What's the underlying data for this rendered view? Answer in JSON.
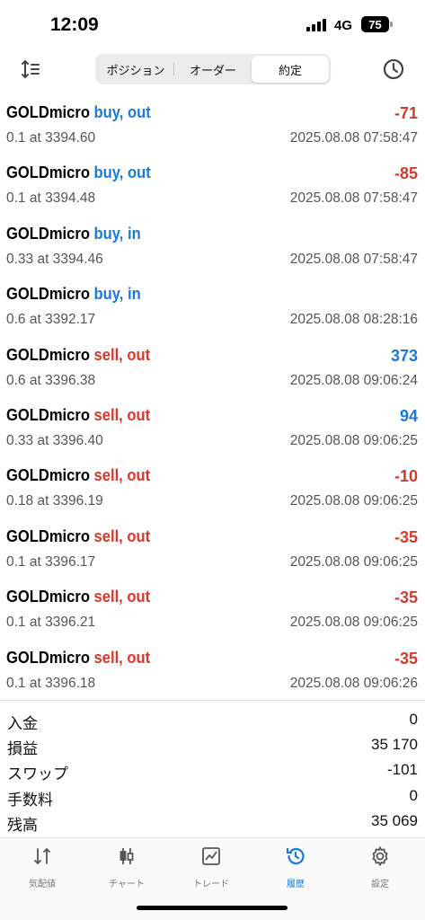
{
  "status": {
    "time": "12:09",
    "network": "4G",
    "battery": "75"
  },
  "tabs_top": [
    {
      "label": "ポジション"
    },
    {
      "label": "オーダー"
    },
    {
      "label": "約定"
    }
  ],
  "deals": [
    {
      "symbol": "GOLDmicro",
      "action": "buy, out",
      "side": "buy",
      "profit": "-71",
      "sign": "neg",
      "volume": "0.1 at 3394.60",
      "time": "2025.08.08 07:58:47"
    },
    {
      "symbol": "GOLDmicro",
      "action": "buy, out",
      "side": "buy",
      "profit": "-85",
      "sign": "neg",
      "volume": "0.1 at 3394.48",
      "time": "2025.08.08 07:58:47"
    },
    {
      "symbol": "GOLDmicro",
      "action": "buy, in",
      "side": "buy",
      "profit": "",
      "sign": "neg",
      "volume": "0.33 at 3394.46",
      "time": "2025.08.08 07:58:47"
    },
    {
      "symbol": "GOLDmicro",
      "action": "buy, in",
      "side": "buy",
      "profit": "",
      "sign": "neg",
      "volume": "0.6 at 3392.17",
      "time": "2025.08.08 08:28:16"
    },
    {
      "symbol": "GOLDmicro",
      "action": "sell, out",
      "side": "sell",
      "profit": "373",
      "sign": "pos",
      "volume": "0.6 at 3396.38",
      "time": "2025.08.08 09:06:24"
    },
    {
      "symbol": "GOLDmicro",
      "action": "sell, out",
      "side": "sell",
      "profit": "94",
      "sign": "pos",
      "volume": "0.33 at 3396.40",
      "time": "2025.08.08 09:06:25"
    },
    {
      "symbol": "GOLDmicro",
      "action": "sell, out",
      "side": "sell",
      "profit": "-10",
      "sign": "neg",
      "volume": "0.18 at 3396.19",
      "time": "2025.08.08 09:06:25"
    },
    {
      "symbol": "GOLDmicro",
      "action": "sell, out",
      "side": "sell",
      "profit": "-35",
      "sign": "neg",
      "volume": "0.1 at 3396.17",
      "time": "2025.08.08 09:06:25"
    },
    {
      "symbol": "GOLDmicro",
      "action": "sell, out",
      "side": "sell",
      "profit": "-35",
      "sign": "neg",
      "volume": "0.1 at 3396.21",
      "time": "2025.08.08 09:06:25"
    },
    {
      "symbol": "GOLDmicro",
      "action": "sell, out",
      "side": "sell",
      "profit": "-35",
      "sign": "neg",
      "volume": "0.1 at 3396.18",
      "time": "2025.08.08 09:06:26"
    }
  ],
  "summary": [
    {
      "label": "入金",
      "value": "0"
    },
    {
      "label": "損益",
      "value": "35 170"
    },
    {
      "label": "スワップ",
      "value": "-101"
    },
    {
      "label": "手数料",
      "value": "0"
    },
    {
      "label": "残高",
      "value": "35 069"
    }
  ],
  "tabbar": [
    {
      "label": "気配値",
      "icon": "quotes-icon"
    },
    {
      "label": "チャート",
      "icon": "chart-icon"
    },
    {
      "label": "トレード",
      "icon": "trade-icon"
    },
    {
      "label": "履歴",
      "icon": "history-icon"
    },
    {
      "label": "設定",
      "icon": "settings-icon"
    }
  ],
  "colors": {
    "buy": "#1a7ad8",
    "sell": "#d33a2c",
    "active_tab": "#1a7ad8"
  }
}
